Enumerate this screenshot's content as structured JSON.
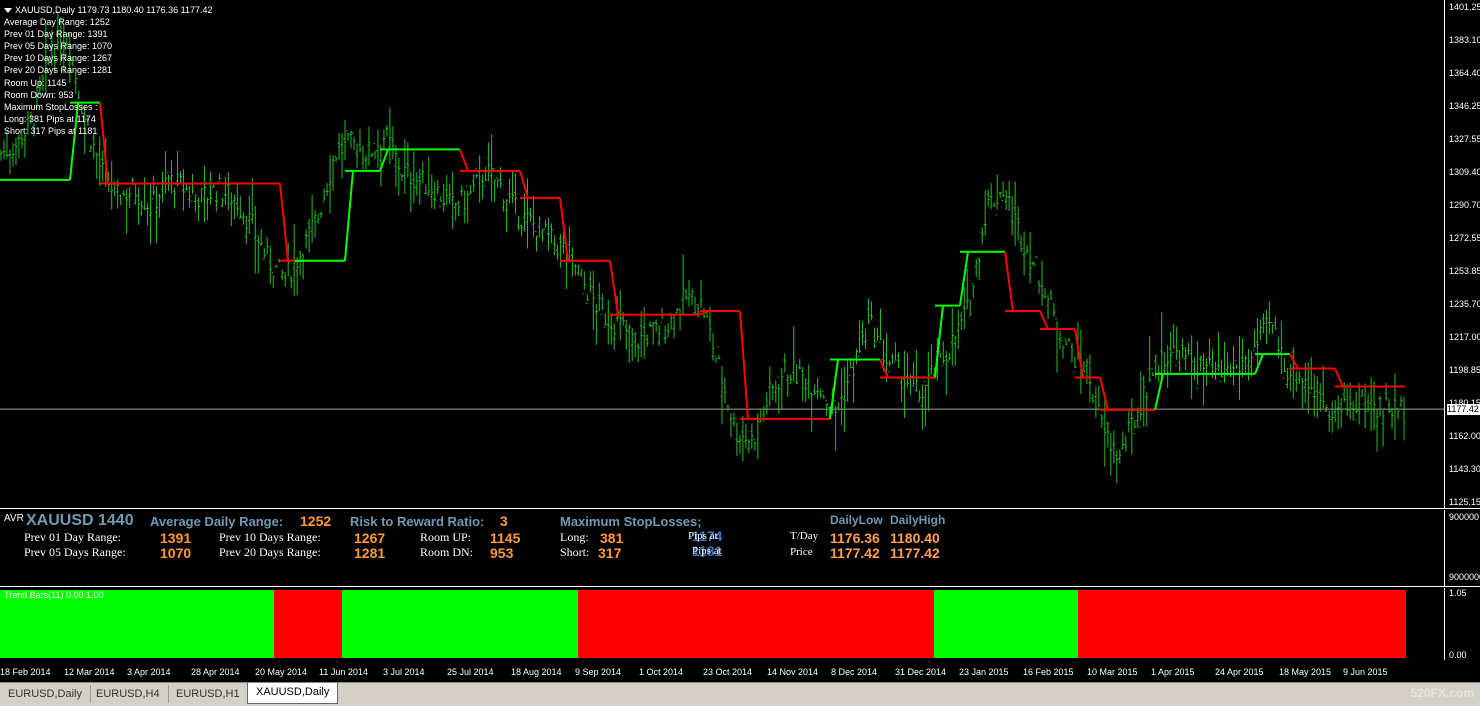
{
  "chart": {
    "title_line": "XAUUSD,Daily  1179.73 1180.40 1176.36 1177.42",
    "info_lines": [
      "Average Day  Range: 1252",
      "Prev 01  Day  Range: 1391",
      "Prev 05  Days Range: 1070",
      "Prev 10  Days Range: 1267",
      "Prev 20  Days Range: 1281",
      "Room Up:     1145",
      "Room Down: 953",
      "Maximum StopLosses :",
      "Long:  381 Pips at 1174",
      "Short: 317 Pips at 1181"
    ],
    "price_ticks": [
      "1401.25",
      "1383.10",
      "1364.40",
      "1346.25",
      "1327.55",
      "1309.40",
      "1290.70",
      "1272.55",
      "1253.85",
      "1235.70",
      "1217.00",
      "1198.85",
      "1180.15",
      "1162.00",
      "1143.30",
      "1125.15"
    ],
    "current_price": "1177.42",
    "colors": {
      "bull": "#21c021",
      "trail_up": "#00ff00",
      "trail_down": "#ff0000",
      "bg": "#000000"
    }
  },
  "chart_data": {
    "type": "ohlc",
    "symbol": "XAUUSD",
    "timeframe": "Daily",
    "ylim": [
      1125.15,
      1401.25
    ],
    "x_ticks": [
      "18 Feb 2014",
      "12 Mar 2014",
      "3 Apr 2014",
      "28 Apr 2014",
      "20 May 2014",
      "11 Jun 2014",
      "3 Jul 2014",
      "25 Jul 2014",
      "18 Aug 2014",
      "9 Sep 2014",
      "1 Oct 2014",
      "23 Oct 2014",
      "14 Nov 2014",
      "8 Dec 2014",
      "31 Dec 2014",
      "23 Jan 2015",
      "16 Feb 2015",
      "10 Mar 2015",
      "1 Apr 2015",
      "24 Apr 2015",
      "18 May 2015",
      "9 Jun 2015"
    ],
    "close_path": [
      1320,
      1325,
      1340,
      1375,
      1385,
      1340,
      1310,
      1295,
      1300,
      1290,
      1305,
      1300,
      1295,
      1300,
      1295,
      1280,
      1260,
      1250,
      1265,
      1285,
      1320,
      1325,
      1320,
      1330,
      1310,
      1305,
      1300,
      1290,
      1295,
      1310,
      1300,
      1285,
      1280,
      1270,
      1265,
      1245,
      1230,
      1225,
      1215,
      1220,
      1225,
      1240,
      1235,
      1200,
      1165,
      1160,
      1185,
      1200,
      1195,
      1190,
      1175,
      1200,
      1225,
      1205,
      1195,
      1185,
      1200,
      1215,
      1235,
      1290,
      1300,
      1275,
      1255,
      1230,
      1210,
      1200,
      1165,
      1150,
      1175,
      1200,
      1210,
      1205,
      1200,
      1195,
      1200,
      1210,
      1225,
      1200,
      1195,
      1185,
      1175,
      1180,
      1180,
      1178,
      1177
    ],
    "trail_steps": [
      {
        "from": 0,
        "to": 70,
        "level": 1305,
        "dir": "up"
      },
      {
        "from": 70,
        "to": 100,
        "level": 1348,
        "dir": "up"
      },
      {
        "from": 100,
        "to": 120,
        "level": 1303,
        "dir": "down"
      },
      {
        "from": 120,
        "to": 280,
        "level": 1303,
        "dir": "down"
      },
      {
        "from": 280,
        "to": 295,
        "level": 1260,
        "dir": "down"
      },
      {
        "from": 295,
        "to": 345,
        "level": 1260,
        "dir": "up"
      },
      {
        "from": 345,
        "to": 380,
        "level": 1310,
        "dir": "up"
      },
      {
        "from": 380,
        "to": 460,
        "level": 1322,
        "dir": "up"
      },
      {
        "from": 460,
        "to": 520,
        "level": 1310,
        "dir": "down"
      },
      {
        "from": 520,
        "to": 560,
        "level": 1295,
        "dir": "down"
      },
      {
        "from": 560,
        "to": 610,
        "level": 1260,
        "dir": "down"
      },
      {
        "from": 610,
        "to": 700,
        "level": 1230,
        "dir": "down"
      },
      {
        "from": 700,
        "to": 740,
        "level": 1232,
        "dir": "down"
      },
      {
        "from": 740,
        "to": 830,
        "level": 1172,
        "dir": "down"
      },
      {
        "from": 830,
        "to": 880,
        "level": 1205,
        "dir": "up"
      },
      {
        "from": 880,
        "to": 935,
        "level": 1195,
        "dir": "down"
      },
      {
        "from": 935,
        "to": 960,
        "level": 1235,
        "dir": "up"
      },
      {
        "from": 960,
        "to": 1005,
        "level": 1265,
        "dir": "up"
      },
      {
        "from": 1005,
        "to": 1040,
        "level": 1232,
        "dir": "down"
      },
      {
        "from": 1040,
        "to": 1075,
        "level": 1222,
        "dir": "down"
      },
      {
        "from": 1075,
        "to": 1100,
        "level": 1195,
        "dir": "down"
      },
      {
        "from": 1100,
        "to": 1155,
        "level": 1177,
        "dir": "down"
      },
      {
        "from": 1155,
        "to": 1255,
        "level": 1197,
        "dir": "up"
      },
      {
        "from": 1255,
        "to": 1290,
        "level": 1208,
        "dir": "up"
      },
      {
        "from": 1290,
        "to": 1335,
        "level": 1200,
        "dir": "down"
      },
      {
        "from": 1335,
        "to": 1405,
        "level": 1190,
        "dir": "down"
      }
    ]
  },
  "avr_panel": {
    "tag": "AVR",
    "symbol": "XAUUSD 1440",
    "avg_label": "Average Daily Range:",
    "avg_value": "1252",
    "rr_label": "Risk to Reward Ratio:",
    "rr_value": "3",
    "sl_label": "Maximum StopLosses;",
    "prev01_label": "Prev 01 Day Range:",
    "prev01_value": "1391",
    "prev05_label": "Prev 05 Days Range:",
    "prev05_value": "1070",
    "prev10_label": "Prev 10 Days Range:",
    "prev10_value": "1267",
    "prev20_label": "Prev 20 Days Range:",
    "prev20_value": "1281",
    "room_up_label": "Room UP:",
    "room_up_value": "1145",
    "room_dn_label": "Room DN:",
    "room_dn_value": "953",
    "long_label": "Long:",
    "long_value": "381",
    "short_label": "Short:",
    "short_value": "317",
    "pips_at_1": "Pips at",
    "pips_at_2": "Pips at",
    "pips_long_price": "1174",
    "pips_short_price": "1181",
    "daily_low_label": "DailyLow",
    "daily_high_label": "DailyHigh",
    "tday_label": "T/Day",
    "price_label": "Price",
    "tday_low": "1176.36",
    "tday_high": "1180.40",
    "price_low": "1177.42",
    "price_high": "1177.42",
    "axis_top": "900000",
    "axis_bottom": "9000000"
  },
  "trend_panel": {
    "label": "Trend Bars(11) 0.00 1.00",
    "axis_top": "1.05",
    "axis_bottom": "0.00",
    "segments": [
      {
        "from": 0,
        "to": 274,
        "color": "#00ff00"
      },
      {
        "from": 274,
        "to": 342,
        "color": "#ff0000"
      },
      {
        "from": 342,
        "to": 578,
        "color": "#00ff00"
      },
      {
        "from": 578,
        "to": 934,
        "color": "#ff0000"
      },
      {
        "from": 934,
        "to": 1078,
        "color": "#00ff00"
      },
      {
        "from": 1078,
        "to": 1406,
        "color": "#ff0000"
      }
    ]
  },
  "tabs": [
    {
      "label": "EURUSD,Daily",
      "active": false
    },
    {
      "label": "EURUSD,H4",
      "active": false
    },
    {
      "label": "EURUSD,H1",
      "active": false
    },
    {
      "label": "XAUUSD,Daily",
      "active": true
    }
  ],
  "watermark": "520FX.com"
}
